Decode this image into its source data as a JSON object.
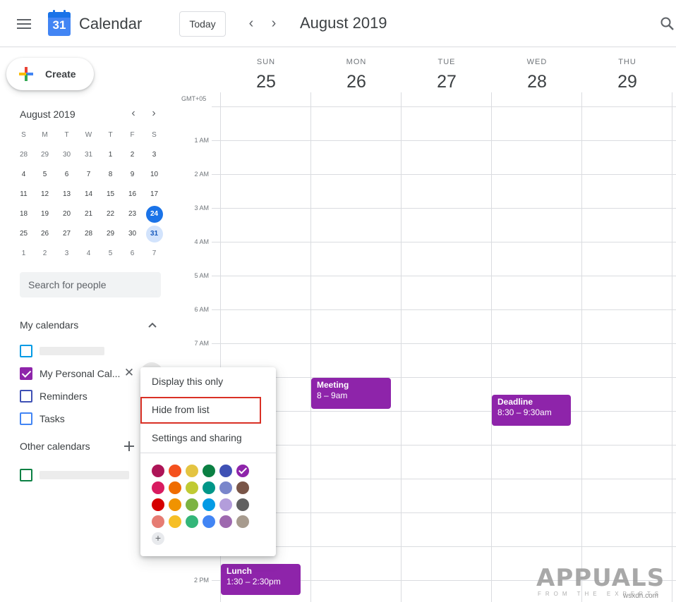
{
  "header": {
    "app_title": "Calendar",
    "logo_day": "31",
    "today_label": "Today",
    "prev_label": "‹",
    "next_label": "›",
    "current_period": "August 2019",
    "search_icon": "search-icon"
  },
  "sidebar": {
    "create_label": "Create",
    "mini_calendar": {
      "title": "August 2019",
      "prev_label": "‹",
      "next_label": "›",
      "weekdays": [
        "S",
        "M",
        "T",
        "W",
        "T",
        "F",
        "S"
      ],
      "weeks": [
        [
          "28",
          "29",
          "30",
          "31",
          "1",
          "2",
          "3"
        ],
        [
          "4",
          "5",
          "6",
          "7",
          "8",
          "9",
          "10"
        ],
        [
          "11",
          "12",
          "13",
          "14",
          "15",
          "16",
          "17"
        ],
        [
          "18",
          "19",
          "20",
          "21",
          "22",
          "23",
          "24"
        ],
        [
          "25",
          "26",
          "27",
          "28",
          "29",
          "30",
          "31"
        ],
        [
          "1",
          "2",
          "3",
          "4",
          "5",
          "6",
          "7"
        ]
      ],
      "today": "24",
      "selected": "31"
    },
    "people_search_placeholder": "Search for people",
    "my_calendars": {
      "title": "My calendars",
      "items": [
        {
          "label": "",
          "color": "#039be5",
          "checked": false
        },
        {
          "label": "My Personal Cal...",
          "color": "#8e24aa",
          "checked": true
        },
        {
          "label": "Reminders",
          "color": "#3f51b5",
          "checked": false
        },
        {
          "label": "Tasks",
          "color": "#4285f4",
          "checked": false
        }
      ]
    },
    "other_calendars": {
      "title": "Other calendars",
      "items": [
        {
          "label": "",
          "color": "#0b8043",
          "checked": false
        }
      ]
    }
  },
  "grid": {
    "timezone": "GMT+05",
    "days": [
      {
        "dow": "SUN",
        "num": "25"
      },
      {
        "dow": "MON",
        "num": "26"
      },
      {
        "dow": "TUE",
        "num": "27"
      },
      {
        "dow": "WED",
        "num": "28"
      },
      {
        "dow": "THU",
        "num": "29"
      }
    ],
    "times": [
      "1 AM",
      "2 AM",
      "3 AM",
      "4 AM",
      "5 AM",
      "6 AM",
      "7 AM",
      "2 PM"
    ],
    "events": [
      {
        "title": "Meeting",
        "time": "8 – 9am",
        "day": "MON",
        "color": "#8e24aa"
      },
      {
        "title": "Deadline",
        "time": "8:30 – 9:30am",
        "day": "WED",
        "color": "#8e24aa"
      },
      {
        "title": "Lunch",
        "time": "1:30 – 2:30pm",
        "day": "SUN",
        "color": "#8e24aa"
      }
    ]
  },
  "popup_menu": {
    "items": [
      "Display this only",
      "Hide from list",
      "Settings and sharing"
    ],
    "highlighted": "Hide from list",
    "colors": [
      [
        "#ad1457",
        "#f4511e",
        "#e4c441",
        "#0b8043",
        "#3f51b5",
        "#8e24aa"
      ],
      [
        "#d81b60",
        "#ef6c00",
        "#c0ca33",
        "#009688",
        "#7986cb",
        "#795548"
      ],
      [
        "#d50000",
        "#f09300",
        "#7cb342",
        "#039be5",
        "#b39ddb",
        "#616161"
      ],
      [
        "#e67c73",
        "#f6bf26",
        "#33b679",
        "#4285f4",
        "#9e69af",
        "#a79b8e"
      ]
    ],
    "selected_color": "#8e24aa",
    "add_color_label": "+"
  },
  "watermark": {
    "brand": "APPUALS",
    "tagline": "FROM THE EXPERTS",
    "site": "wsxdn.com"
  }
}
